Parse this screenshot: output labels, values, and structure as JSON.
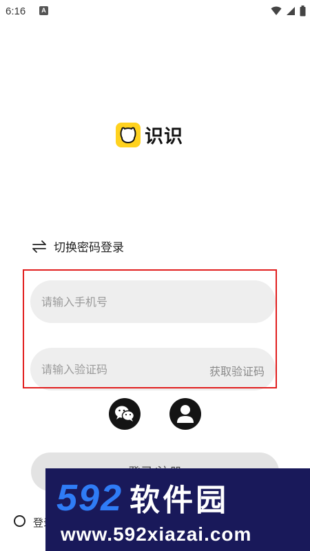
{
  "status_bar": {
    "time": "6:16",
    "app_icon_letter": "A",
    "icons": [
      "wifi-icon",
      "signal-icon",
      "battery-icon"
    ]
  },
  "logo": {
    "icon": "bear-logo-icon",
    "text": "识识",
    "color": "#ffd21f"
  },
  "switch_login": {
    "icon": "swap-arrows-icon",
    "label": "切换密码登录"
  },
  "phone_input": {
    "placeholder": "请输入手机号",
    "value": ""
  },
  "code_input": {
    "placeholder": "请输入验证码",
    "value": "",
    "get_code_label": "获取验证码"
  },
  "social_login": {
    "icons": [
      "wechat-icon",
      "account-icon"
    ]
  },
  "login_button": {
    "label": "登录/注册"
  },
  "agreement": {
    "text": "登录"
  },
  "watermark": {
    "brand_number": "592",
    "brand_name": "软件园",
    "url": "www.592xiazai.com"
  },
  "colors": {
    "highlight": "#e11d1d",
    "input_bg": "#eeeeee",
    "button_bg": "#e3e3e3",
    "watermark_bg": "#19195a",
    "watermark_accent": "#2f7cf6"
  }
}
